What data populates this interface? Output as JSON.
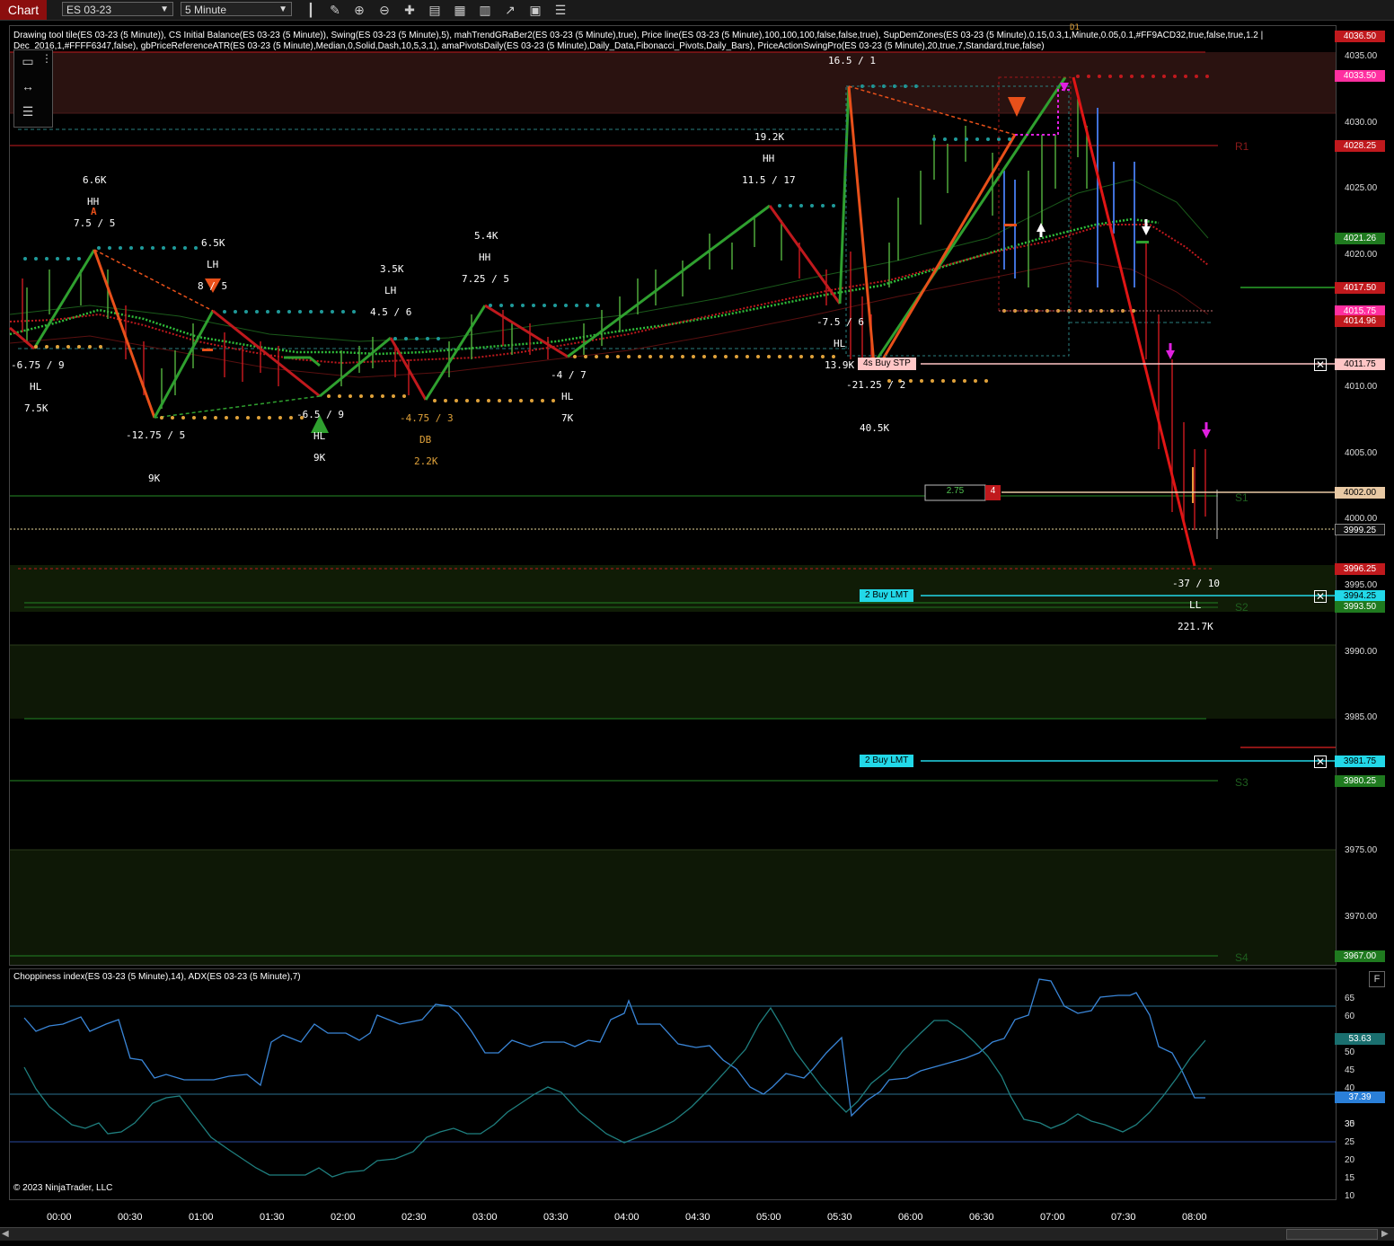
{
  "toolbar": {
    "chart_tab": "Chart",
    "instrument": "ES 03-23",
    "interval": "5 Minute"
  },
  "indicators_label": "Drawing tool tile(ES 03-23 (5 Minute)), CS Initial Balance(ES 03-23 (5 Minute)), Swing(ES 03-23 (5 Minute),5), mahTrendGRaBer2(ES 03-23 (5 Minute),true), Price line(ES 03-23 (5 Minute),100,100,100,false,false,true), SupDemZones(ES 03-23 (5 Minute),0.15,0.3,1,Minute,0.05,0.1,#FF9ACD32,true,false,true,1.2 | Dec_2016,1,#FFFF6347,false), gbPriceReferenceATR(ES 03-23 (5 Minute),Median,0,Solid,Dash,10,5,3,1), amaPivotsDaily(ES 03-23 (5 Minute),Daily_Data,Fibonacci_Pivots,Daily_Bars), PriceActionSwingPro(ES 03-23 (5 Minute),20,true,7,Standard,true,false)",
  "sub_label": "Choppiness index(ES 03-23 (5 Minute),14), ADX(ES 03-23 (5 Minute),7)",
  "copyright": "© 2023 NinjaTrader, LLC",
  "price_axis": [
    "4035.00",
    "4030.00",
    "4025.00",
    "4020.00",
    "4010.00",
    "4005.00",
    "4000.00",
    "3995.00",
    "3990.00",
    "3985.00",
    "3975.00",
    "3970.00"
  ],
  "price_tags": [
    {
      "label": "4036.50",
      "bg": "#c0191d",
      "fg": "#ffffff"
    },
    {
      "label": "4033.50",
      "bg": "#ff2fa0",
      "fg": "#ffffff"
    },
    {
      "label": "4028.25",
      "bg": "#c0191d",
      "fg": "#ffffff"
    },
    {
      "label": "4021.26",
      "bg": "#1f7a1f",
      "fg": "#ffffff"
    },
    {
      "label": "4017.50",
      "bg": "#c0191d",
      "fg": "#ffffff"
    },
    {
      "label": "4015.75",
      "bg": "#ff2fa0",
      "fg": "#ffffff"
    },
    {
      "label": "4014.96",
      "bg": "#c0191d",
      "fg": "#ffffff"
    },
    {
      "label": "4011.75",
      "bg": "#ffc6c6",
      "fg": "#000000"
    },
    {
      "label": "4002.00",
      "bg": "#e8c9a4",
      "fg": "#000000"
    },
    {
      "label": "3999.25",
      "bg": "#111111",
      "fg": "#ffffff"
    },
    {
      "label": "3996.25",
      "bg": "#c0191d",
      "fg": "#ffffff"
    },
    {
      "label": "3994.25",
      "bg": "#22d8e8",
      "fg": "#000000"
    },
    {
      "label": "3993.50",
      "bg": "#1f7a1f",
      "fg": "#ffffff"
    },
    {
      "label": "3981.75",
      "bg": "#22d8e8",
      "fg": "#000000"
    },
    {
      "label": "3980.25",
      "bg": "#1f7a1f",
      "fg": "#ffffff"
    },
    {
      "label": "3967.00",
      "bg": "#1f7a1f",
      "fg": "#ffffff"
    }
  ],
  "sub_axis": [
    "65",
    "60",
    "50",
    "45",
    "40",
    "35",
    "30",
    "25",
    "20",
    "15",
    "10"
  ],
  "sub_tags": [
    {
      "label": "53.63",
      "bg": "#1a6f6f",
      "fg": "#ffffff"
    },
    {
      "label": "37.39",
      "bg": "#2a7fd8",
      "fg": "#ffffff"
    }
  ],
  "time_axis": [
    "00:00",
    "00:30",
    "01:00",
    "01:30",
    "02:00",
    "02:30",
    "03:00",
    "03:30",
    "04:00",
    "04:30",
    "05:00",
    "05:30",
    "06:00",
    "06:30",
    "07:00",
    "07:30",
    "08:00"
  ],
  "orders": [
    {
      "label": "4s  Buy STP",
      "bg": "#ffc6c6",
      "fg": "#000000"
    },
    {
      "label": "2  Buy LMT",
      "bg": "#22d8e8",
      "fg": "#000000"
    },
    {
      "label": "2  Buy LMT",
      "bg": "#22d8e8",
      "fg": "#000000"
    }
  ],
  "position_box": {
    "pnl": "2.75",
    "qty": "4"
  },
  "pivot_labels": [
    "R1",
    "S1",
    "S2",
    "S3",
    "S4"
  ],
  "swing_texts": [
    "6.6K",
    "HH",
    "7.5 / 5",
    "A",
    "6.5K",
    "LH",
    "8  / 5",
    "-6.75 / 9",
    "HL",
    "7.5K",
    "-12.75 / 5",
    "9K",
    "3.5K",
    "LH",
    "4.5 / 6",
    "-6.5 / 9",
    "HL",
    "9K",
    "5.4K",
    "HH",
    "7.25 / 5",
    "-4.75 / 3",
    "DB",
    "2.2K",
    "-4 / 7",
    "HL",
    "7K",
    "19.2K",
    "HH",
    "11.5 / 17",
    "16.5 / 1",
    "-7.5 / 6",
    "HL",
    "13.9K",
    "-21.25 / 2",
    "40.5K",
    "-37 / 10",
    "LL",
    "221.7K",
    "D1"
  ]
}
